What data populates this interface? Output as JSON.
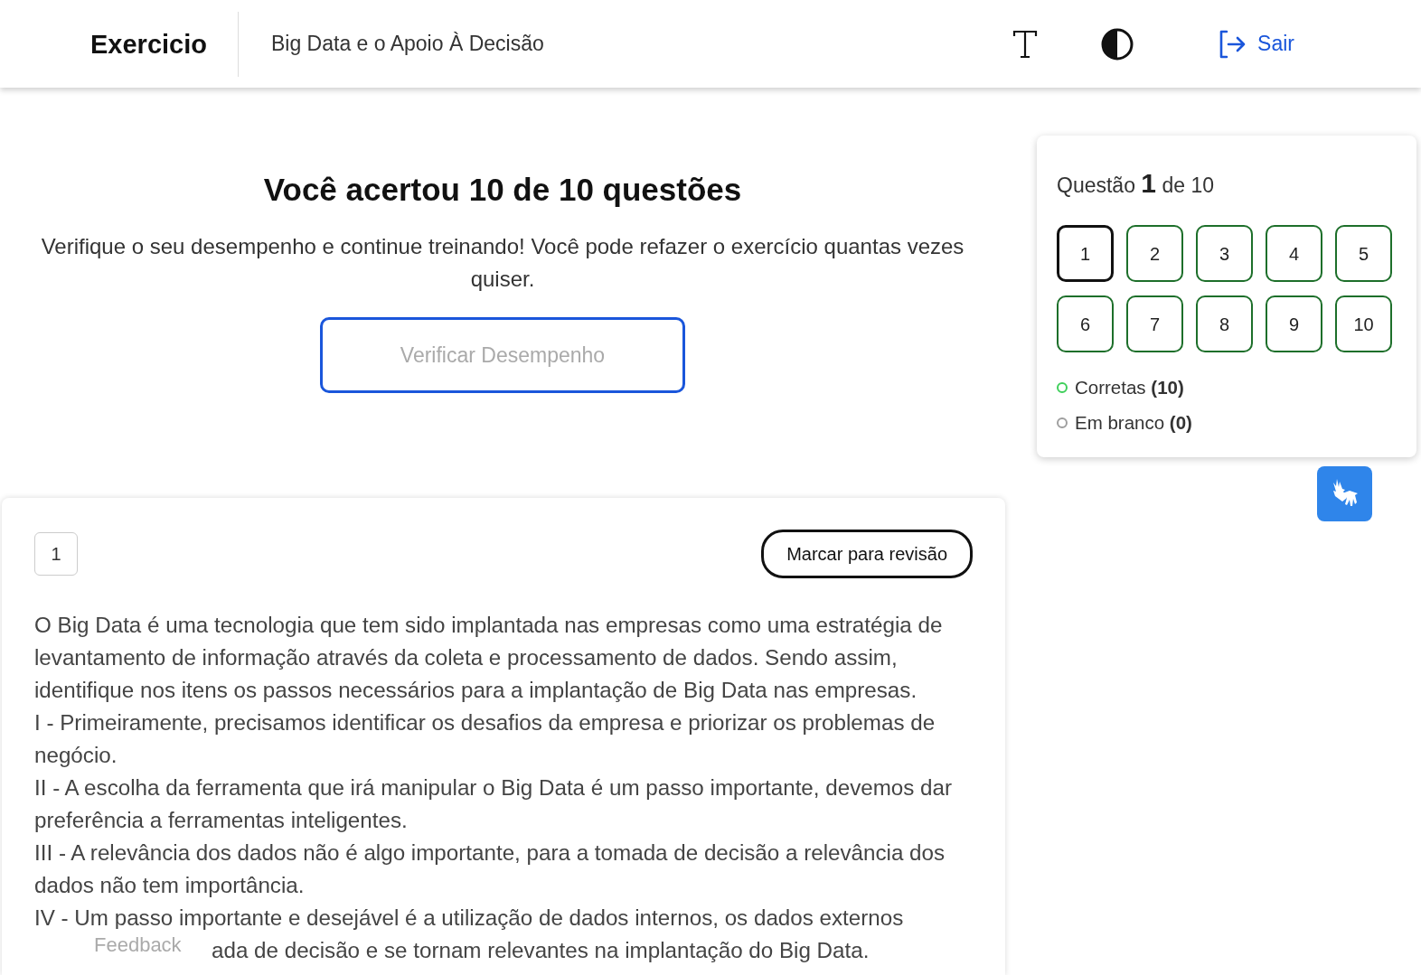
{
  "header": {
    "title": "Exercicio",
    "subtitle": "Big Data e o Apoio À Decisão",
    "logout": "Sair"
  },
  "result": {
    "title": "Você acertou 10 de 10 questões",
    "text": "Verifique o seu desempenho e continue treinando! Você pode refazer o exercício quantas vezes quiser.",
    "button": "Verificar Desempenho"
  },
  "question": {
    "number": "1",
    "review_button": "Marcar para revisão",
    "paragraphs": [
      "O Big Data é uma tecnologia que tem sido implantada nas empresas como uma estratégia de levantamento de informação através da coleta e processamento de dados. Sendo assim, identifique nos itens os passos necessários para a implantação de Big Data nas empresas.",
      "I - Primeiramente, precisamos identificar os desafios da empresa e priorizar os problemas de negócio.",
      "II - A escolha da ferramenta que irá manipular o Big Data é um passo importante, devemos dar preferência a ferramentas inteligentes.",
      "III - A relevância dos dados não é algo importante, para a tomada de decisão a relevância dos dados não tem importância.",
      "IV - Um passo importante e desejável é a utilização de dados internos, os dados externos"
    ],
    "partial_line": "ada de decisão e se tornam relevantes na implantação do Big Data."
  },
  "navigator": {
    "label": "Questão",
    "current": "1",
    "of": "de 10",
    "items": [
      {
        "label": "1",
        "color": "#111111",
        "selected": true
      },
      {
        "label": "2",
        "color": "#1d6f2a",
        "selected": false
      },
      {
        "label": "3",
        "color": "#1d6f2a",
        "selected": false
      },
      {
        "label": "4",
        "color": "#1d6f2a",
        "selected": false
      },
      {
        "label": "5",
        "color": "#1d6f2a",
        "selected": false
      },
      {
        "label": "6",
        "color": "#1d6f2a",
        "selected": false
      },
      {
        "label": "7",
        "color": "#1d6f2a",
        "selected": false
      },
      {
        "label": "8",
        "color": "#1d6f2a",
        "selected": false
      },
      {
        "label": "9",
        "color": "#1d6f2a",
        "selected": false
      },
      {
        "label": "10",
        "color": "#1d6f2a",
        "selected": false
      }
    ],
    "legend": [
      {
        "label": "Corretas",
        "count": "(10)",
        "color": "#3ecf5a"
      },
      {
        "label": "Em branco",
        "count": "(0)",
        "color": "#9e9e9e"
      }
    ]
  },
  "feedback": "Feedback"
}
